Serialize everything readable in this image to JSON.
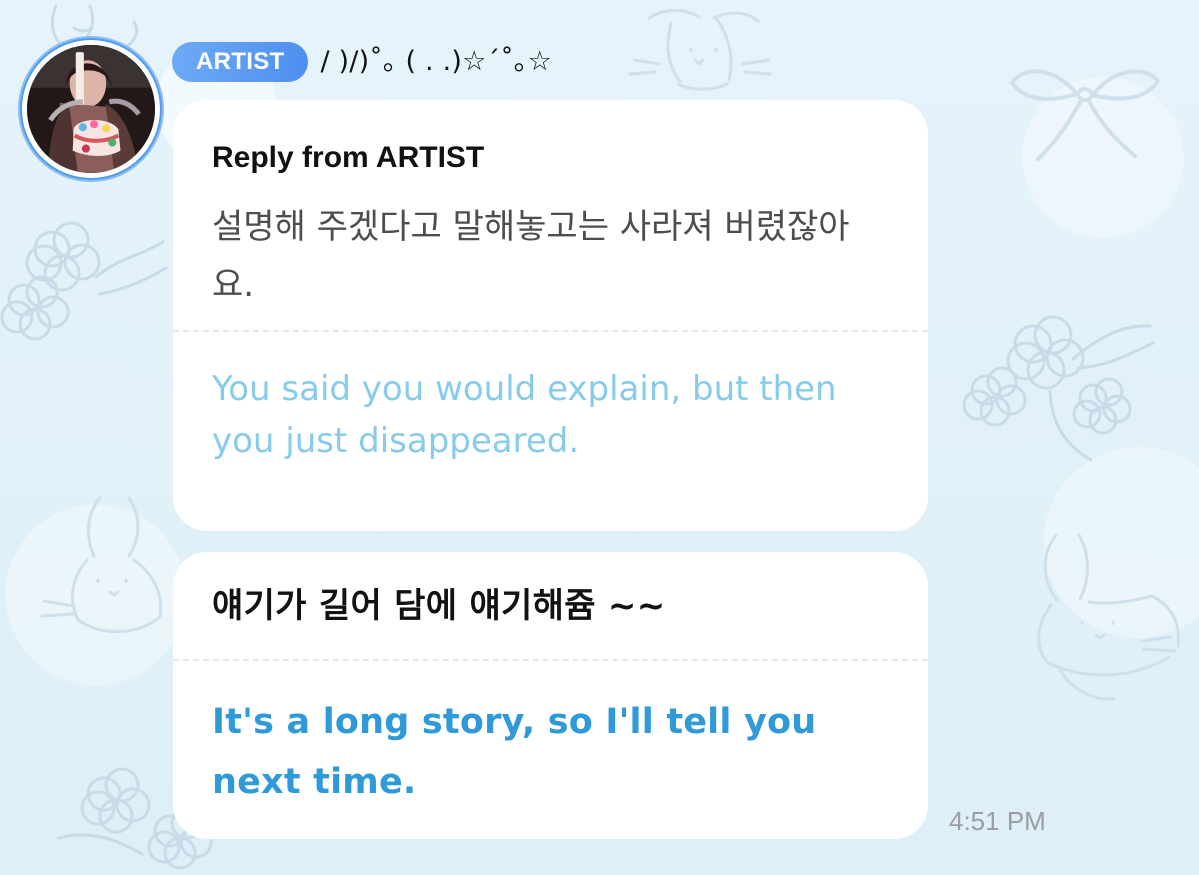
{
  "header": {
    "artist_badge": "ARTIST",
    "artist_name": "/ )/)˚｡ ( . .)☆´˚｡☆"
  },
  "reply_bubble": {
    "label": "Reply from ARTIST",
    "original_text": "설명해 주겠다고 말해놓고는 사라져 버렸잖아요.",
    "translation": "You said you would explain, but then you just disappeared."
  },
  "message_bubble": {
    "original_text": "얘기가 길어 담에 얘기해쥼 ~~",
    "translation": "It's a long story, so I'll tell you next time."
  },
  "timestamp": "4:51 PM",
  "colors": {
    "background": "#e3f1f8",
    "badge": "#5898f2",
    "avatar_ring": "#4f9cf0",
    "reply_translation": "#86cbeb",
    "message_translation": "#2f9ad7",
    "timestamp": "#9a9ea2"
  },
  "icons": {
    "avatar": "profile-photo",
    "decorations": [
      "bunny-icon",
      "bow-icon",
      "flower-icon"
    ]
  }
}
